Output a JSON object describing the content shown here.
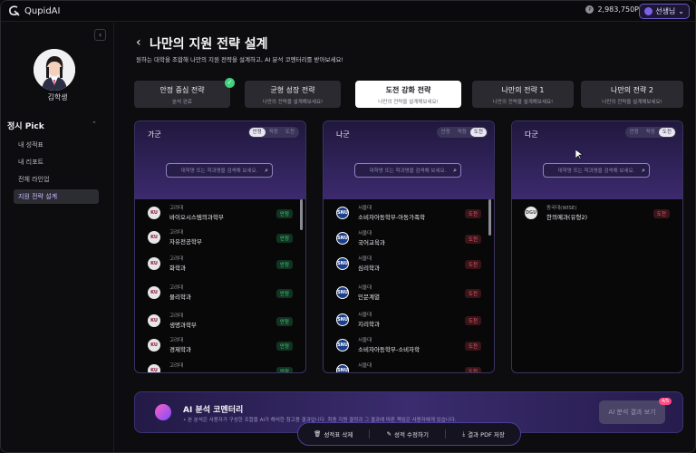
{
  "app": {
    "name": "QupidAI"
  },
  "header": {
    "points": "2,983,750P",
    "user": "선생님",
    "user_chevron": "⌄"
  },
  "sidebar": {
    "student_name": "김학생",
    "section": "정시 Pick",
    "items": [
      {
        "label": "내 성적표",
        "active": false
      },
      {
        "label": "내 리포트",
        "active": false
      },
      {
        "label": "전체 라인업",
        "active": false
      },
      {
        "label": "지원 전략 설계",
        "active": true
      }
    ]
  },
  "page": {
    "title": "나만의 지원 전략 설계",
    "subtitle": "원하는 대학을 조합해 나만의 지원 전략을 설계하고, AI 분석 코멘터리를 받아보세요!"
  },
  "tabs": [
    {
      "label": "안정 중심 전략",
      "sub": "분석 완료",
      "active": false,
      "done": true
    },
    {
      "label": "균형 성장 전략",
      "sub": "나만의 전략을 설계해보세요!",
      "active": false,
      "done": false
    },
    {
      "label": "도전 강화 전략",
      "sub": "나만의 전략을 설계해보세요!",
      "active": true,
      "done": false
    },
    {
      "label": "나만의 전략 1",
      "sub": "나만의 전략을 설계해보세요!",
      "active": false,
      "done": false
    },
    {
      "label": "나만의 전략 2",
      "sub": "나만의 전략을 설계해보세요!",
      "active": false,
      "done": false
    }
  ],
  "search_placeholder": "대학명 또는 학과명을 검색해 보세요.",
  "columns": [
    {
      "title": "가군",
      "segments": [
        "안정",
        "적정",
        "도전"
      ],
      "selected": "안정",
      "rows": [
        {
          "univ": "고려대",
          "major": "바이오시스템의과학부",
          "badge": "안정",
          "logo": "KU"
        },
        {
          "univ": "고려대",
          "major": "자유전공학부",
          "badge": "안정",
          "logo": "KU"
        },
        {
          "univ": "고려대",
          "major": "화학과",
          "badge": "안정",
          "logo": "KU"
        },
        {
          "univ": "고려대",
          "major": "물리학과",
          "badge": "안정",
          "logo": "KU"
        },
        {
          "univ": "고려대",
          "major": "생명과학부",
          "badge": "안정",
          "logo": "KU"
        },
        {
          "univ": "고려대",
          "major": "경제학과",
          "badge": "안정",
          "logo": "KU"
        },
        {
          "univ": "고려대",
          "major": "",
          "badge": "안정",
          "logo": "KU"
        }
      ]
    },
    {
      "title": "나군",
      "segments": [
        "안정",
        "적정",
        "도전"
      ],
      "selected": "도전",
      "rows": [
        {
          "univ": "서울대",
          "major": "소비자아동학부-아동가족학",
          "badge": "도전",
          "logo": "SNU"
        },
        {
          "univ": "서울대",
          "major": "국어교육과",
          "badge": "도전",
          "logo": "SNU"
        },
        {
          "univ": "서울대",
          "major": "심리학과",
          "badge": "도전",
          "logo": "SNU"
        },
        {
          "univ": "서울대",
          "major": "인문계열",
          "badge": "도전",
          "logo": "SNU"
        },
        {
          "univ": "서울대",
          "major": "지리학과",
          "badge": "도전",
          "logo": "SNU"
        },
        {
          "univ": "서울대",
          "major": "소비자아동학부-소비자학",
          "badge": "도전",
          "logo": "SNU"
        },
        {
          "univ": "서울대",
          "major": "",
          "badge": "도전",
          "logo": "SNU"
        }
      ]
    },
    {
      "title": "다군",
      "segments": [
        "안정",
        "적정",
        "도전"
      ],
      "selected": "도전",
      "rows": [
        {
          "univ": "동국대(WISE)",
          "major": "한의예과(유형2)",
          "badge": "도전",
          "logo": "DGU"
        }
      ]
    }
  ],
  "ai_panel": {
    "title": "AI 분석 코멘터리",
    "subtitle": "• 본 분석은 사용자가 구성한 조합을 AI가 해석한 참고용 결과입니다. 최종 지원 결정과 그 결과에 따른 책임은 사용자에게 있습니다.",
    "button": "AI 분석 결과 보기",
    "badge": "4/5"
  },
  "toolbar": {
    "delete": "성적표 삭제",
    "edit": "성적 수정하기",
    "save": "결과 PDF 저장"
  }
}
